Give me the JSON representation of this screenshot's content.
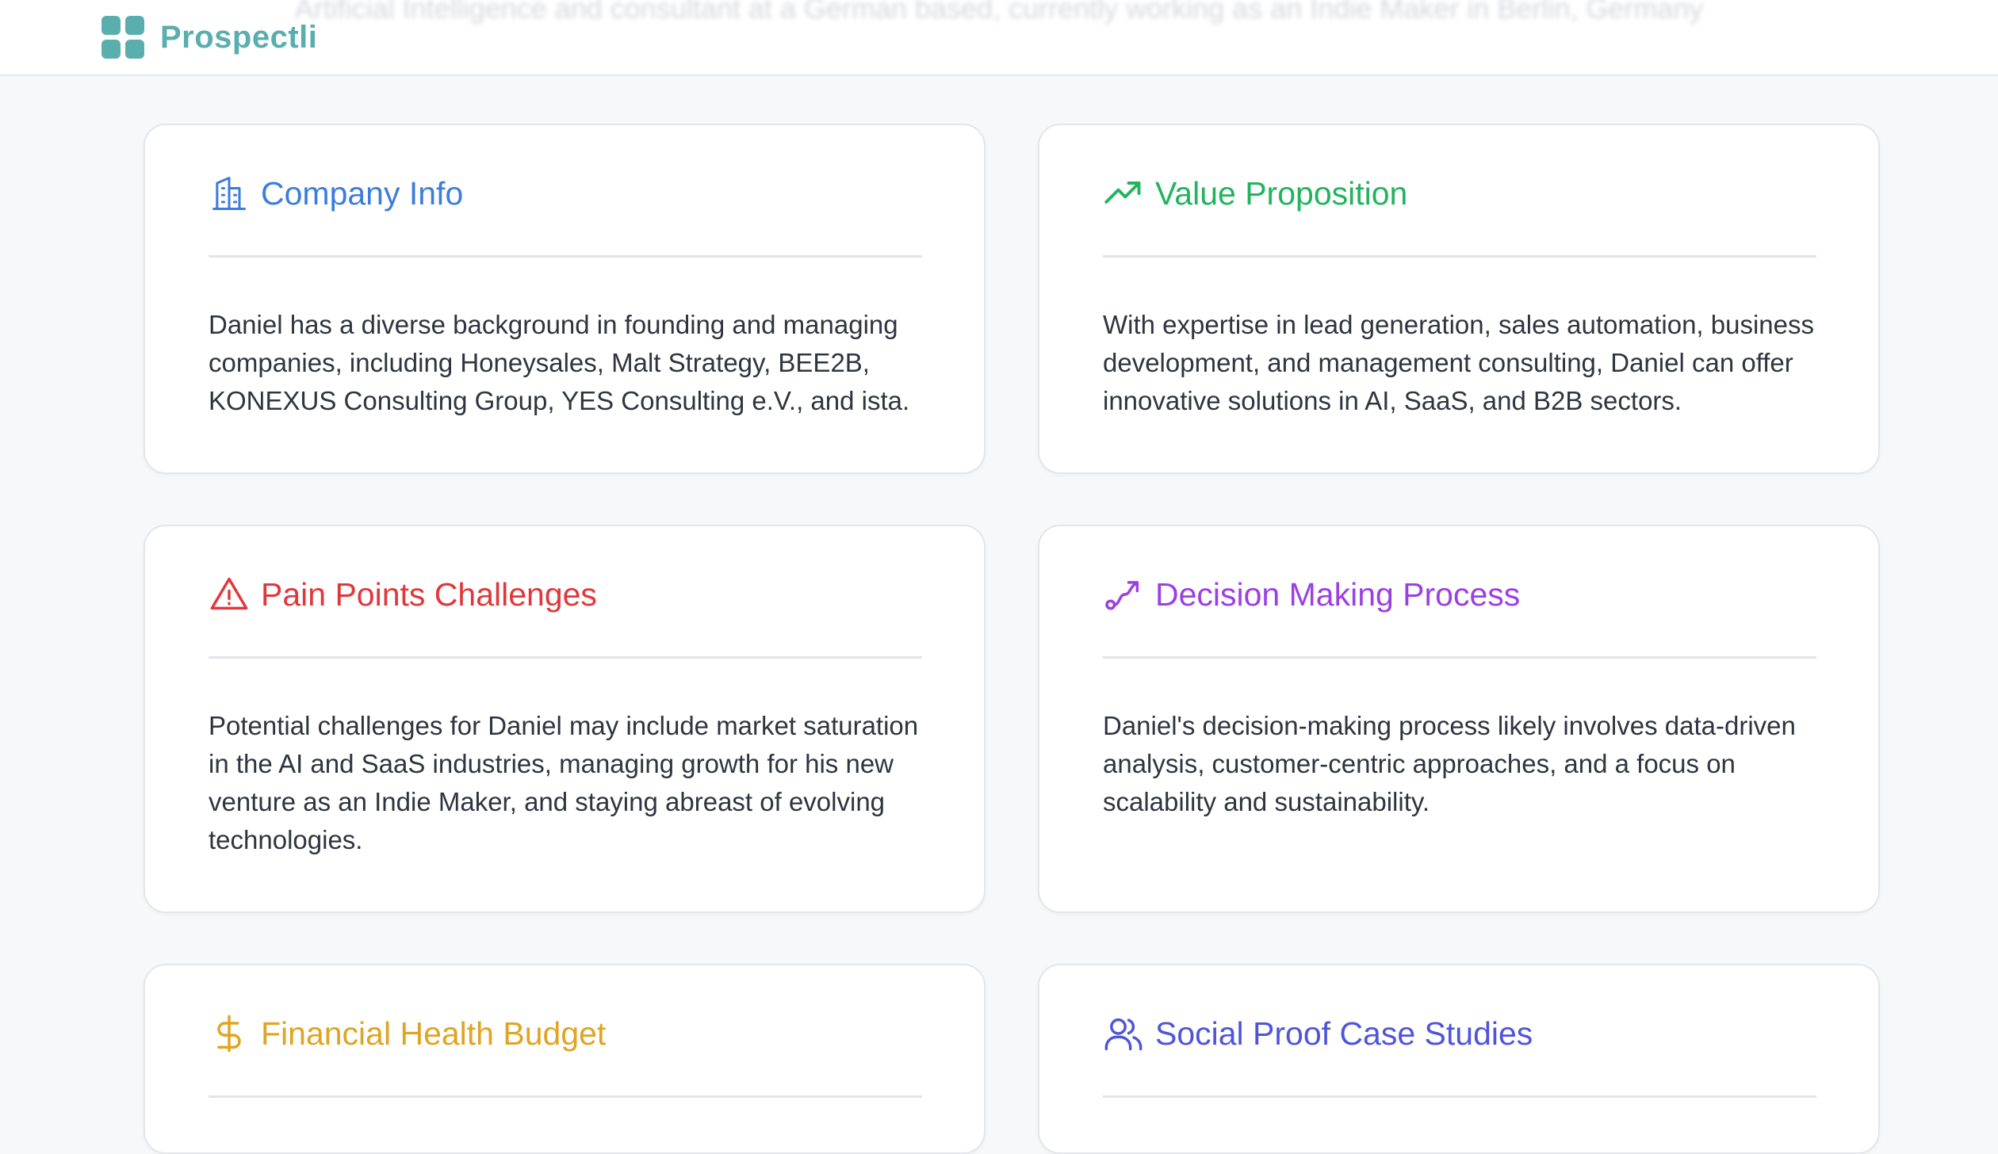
{
  "app": {
    "brand": "Prospectli"
  },
  "header": {
    "background_text": "Artificial Intelligence and consultant at a German based, currently working as an Indie Maker in Berlin, Germany"
  },
  "cards": [
    {
      "title": "Company Info",
      "icon": "building-icon",
      "color": "#3b7ddd",
      "body": "Daniel has a diverse background in founding and managing companies, including Honeysales, Malt Strategy, BEE2B, KONEXUS Consulting Group, YES Consulting e.V., and ista."
    },
    {
      "title": "Value Proposition",
      "icon": "trending-up-icon",
      "color": "#22b35e",
      "body": "With expertise in lead generation, sales automation, business development, and management consulting, Daniel can offer innovative solutions in AI, SaaS, and B2B sectors."
    },
    {
      "title": "Pain Points Challenges",
      "icon": "warning-triangle-icon",
      "color": "#e2373a",
      "body": "Potential challenges for Daniel may include market saturation in the AI and SaaS industries, managing growth for his new venture as an Indie Maker, and staying abreast of evolving technologies."
    },
    {
      "title": "Decision Making Process",
      "icon": "route-icon",
      "color": "#9b3fe6",
      "body": "Daniel's decision-making process likely involves data-driven analysis, customer-centric approaches, and a focus on scalability and sustainability."
    },
    {
      "title": "Financial Health Budget",
      "icon": "dollar-icon",
      "color": "#e0a422",
      "body": ""
    },
    {
      "title": "Social Proof Case Studies",
      "icon": "users-icon",
      "color": "#4f55d9",
      "body": ""
    }
  ]
}
